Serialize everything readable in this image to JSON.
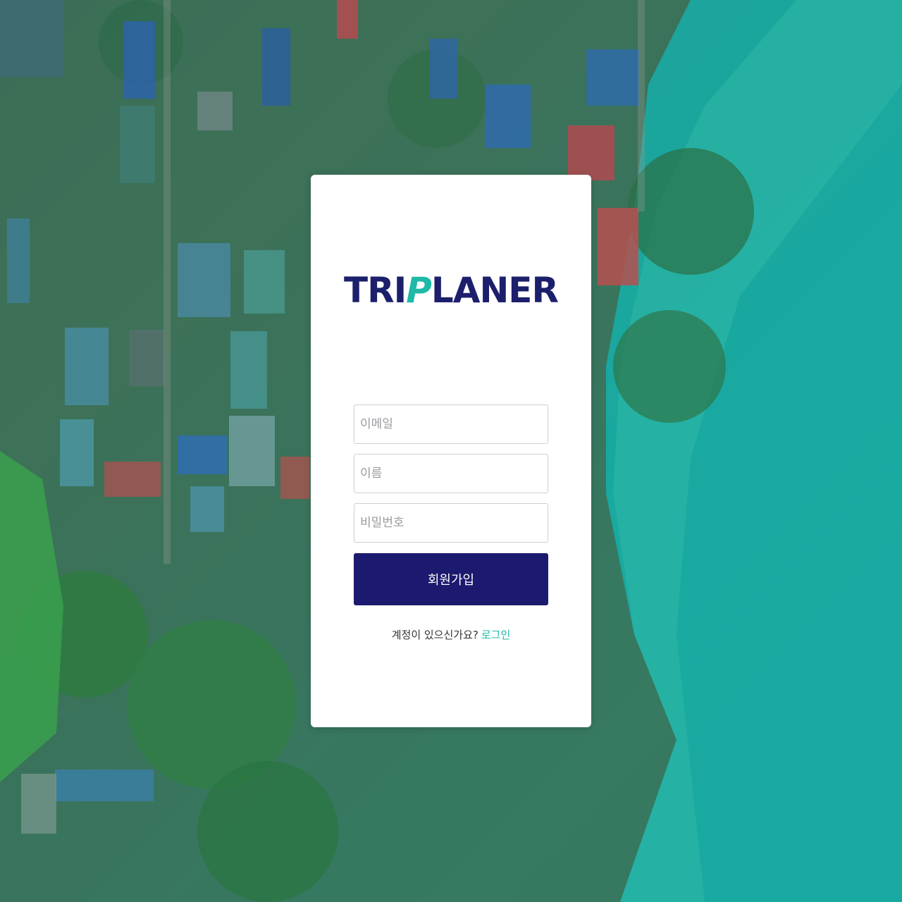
{
  "brand": {
    "logo_prefix": "TRI",
    "logo_accent": "P",
    "logo_suffix": "LANER",
    "primary_color": "#1c1a6e",
    "accent_color": "#1fb9a8"
  },
  "signup_form": {
    "email_placeholder": "이메일",
    "name_placeholder": "이름",
    "password_placeholder": "비밀번호",
    "submit_label": "회원가입"
  },
  "footer": {
    "prompt_text": "계정이 있으신가요?",
    "login_link_label": "로그인"
  }
}
